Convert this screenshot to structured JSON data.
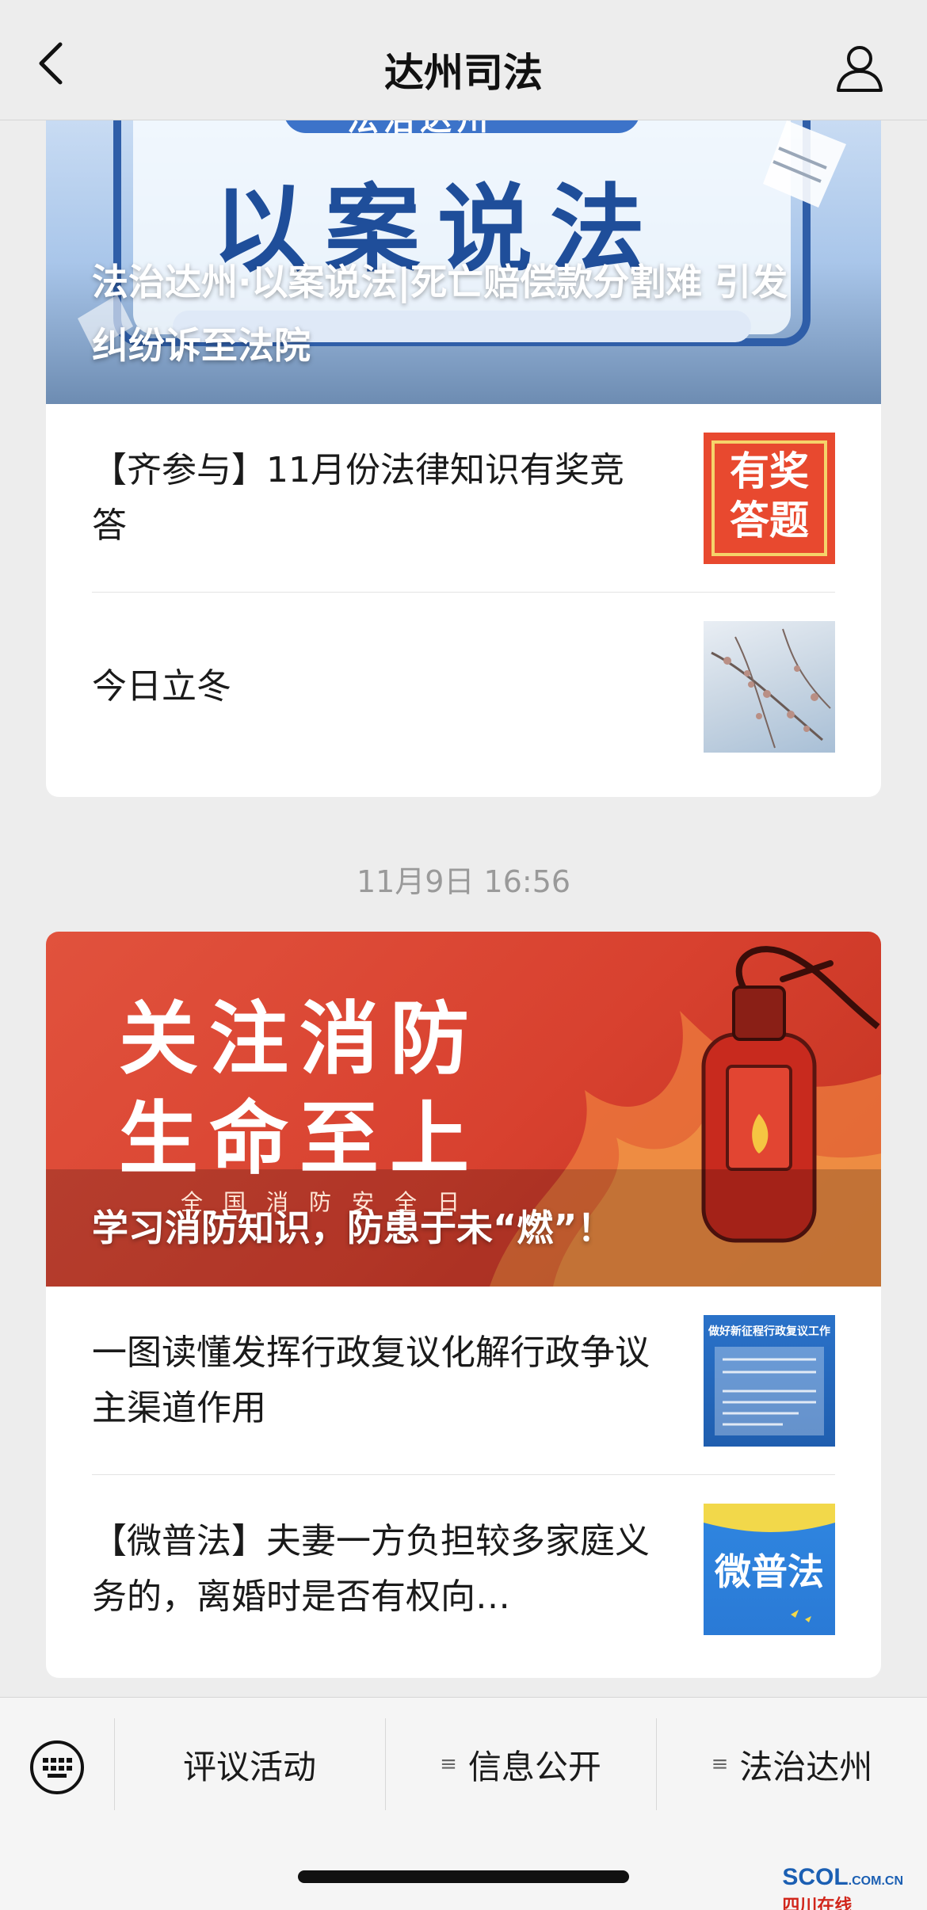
{
  "header": {
    "title": "达州司法"
  },
  "card1": {
    "cover_art_text": "以案说法",
    "cover_art_top": "法治达州",
    "headline": "法治达州·以案说法|死亡赔偿款分割难 引发纠纷诉至法院",
    "articles": [
      {
        "title": "【齐参与】11月份法律知识有奖竞答",
        "thumb_text": "有奖答题"
      },
      {
        "title": "今日立冬"
      }
    ]
  },
  "timestamp": "11月9日 16:56",
  "card2": {
    "cover_art_line1": "关注消防",
    "cover_art_line2": "生命至上",
    "cover_art_sub": "全国消防安全日",
    "headline": "学习消防知识，防患于未“燃”！",
    "articles": [
      {
        "title": "一图读懂发挥行政复议化解行政争议主渠道作用",
        "thumb_text": "做好新征程行政复议工作"
      },
      {
        "title": "【微普法】夫妻一方负担较多家庭义务的，离婚时是否有权向…",
        "thumb_text": "微普法"
      }
    ]
  },
  "bottom_menu": {
    "items": [
      {
        "label": "评议活动"
      },
      {
        "label": "信息公开"
      },
      {
        "label": "法治达州"
      }
    ]
  },
  "watermark": {
    "main": "SCOL",
    "domain": ".COM.CN",
    "sub": "四川在线"
  },
  "colors": {
    "background": "#ededed",
    "fire_red": "#d8412f",
    "legal_blue": "#1f4e9a"
  }
}
